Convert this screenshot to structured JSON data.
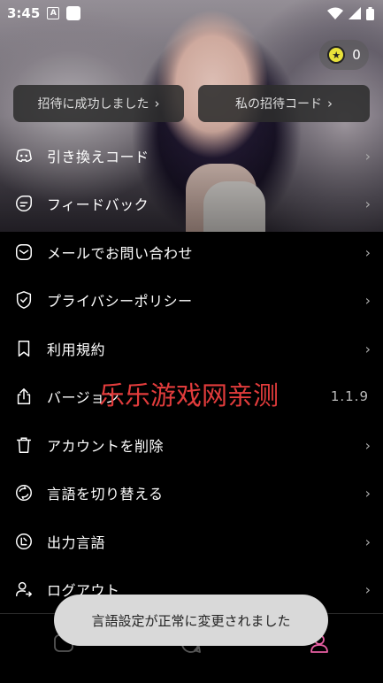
{
  "status_bar": {
    "time": "3:45",
    "notification_letter": "A"
  },
  "coins": {
    "count": "0"
  },
  "invite": {
    "success_label": "招待に成功しました",
    "my_code_label": "私の招待コード"
  },
  "menu": {
    "items": [
      {
        "label": "引き換えコード",
        "icon": "discord-icon"
      },
      {
        "label": "フィードバック",
        "icon": "feedback-icon"
      },
      {
        "label": "メールでお問い合わせ",
        "icon": "mail-icon"
      },
      {
        "label": "プライバシーポリシー",
        "icon": "shield-check-icon"
      },
      {
        "label": "利用規約",
        "icon": "bookmark-icon"
      },
      {
        "label": "バージョン",
        "icon": "share-icon",
        "value": "1.1.9"
      },
      {
        "label": "アカウントを削除",
        "icon": "trash-icon"
      },
      {
        "label": "言語を切り替える",
        "icon": "language-switch-icon"
      },
      {
        "label": "出力言語",
        "icon": "output-language-icon"
      },
      {
        "label": "ログアウト",
        "icon": "logout-icon"
      }
    ]
  },
  "watermark": "乐乐游戏网亲测",
  "toast": {
    "message": "言語設定が正常に変更されました"
  },
  "colors": {
    "accent_pink": "#e85fa3",
    "coin_yellow": "#e8e23a",
    "watermark_red": "#e23c3c"
  }
}
